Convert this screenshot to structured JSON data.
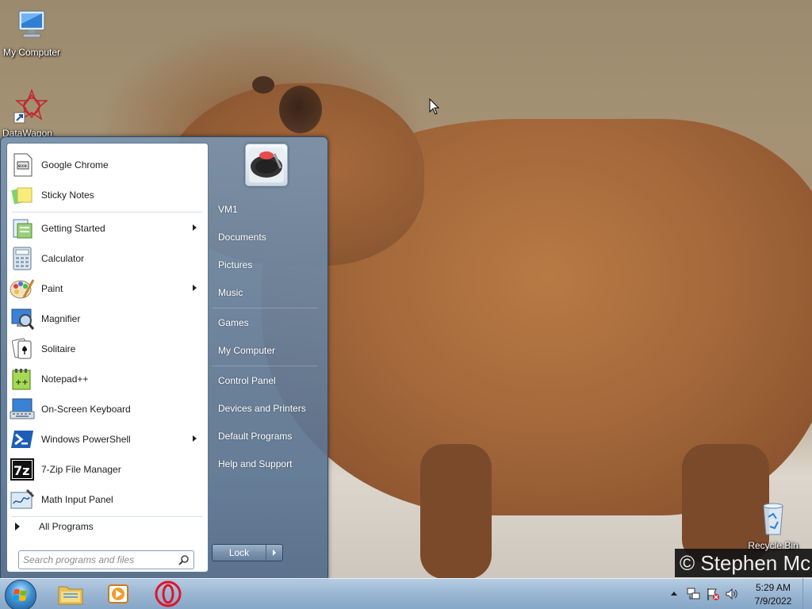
{
  "desktop": {
    "icons": [
      {
        "label": "My Computer"
      },
      {
        "label": "DataWagon"
      },
      {
        "label": "Recycle Bin"
      }
    ],
    "watermark": "© Stephen Mc"
  },
  "start_menu": {
    "programs": [
      {
        "label": "Google Chrome",
        "icon": "chrome-doc-icon",
        "submenu": false
      },
      {
        "label": "Sticky Notes",
        "icon": "sticky-notes-icon",
        "submenu": false
      },
      {
        "label": "Getting Started",
        "icon": "getting-started-icon",
        "submenu": true
      },
      {
        "label": "Calculator",
        "icon": "calculator-icon",
        "submenu": false
      },
      {
        "label": "Paint",
        "icon": "paint-icon",
        "submenu": true
      },
      {
        "label": "Magnifier",
        "icon": "magnifier-icon",
        "submenu": false
      },
      {
        "label": "Solitaire",
        "icon": "solitaire-icon",
        "submenu": false
      },
      {
        "label": "Notepad++",
        "icon": "notepad-plus-icon",
        "submenu": false
      },
      {
        "label": "On-Screen Keyboard",
        "icon": "keyboard-icon",
        "submenu": false
      },
      {
        "label": "Windows PowerShell",
        "icon": "powershell-icon",
        "submenu": true
      },
      {
        "label": "7-Zip File Manager",
        "icon": "seven-zip-icon",
        "submenu": false
      },
      {
        "label": "Math Input Panel",
        "icon": "math-input-icon",
        "submenu": false
      }
    ],
    "all_programs": "All Programs",
    "search_placeholder": "Search programs and files",
    "right_items": [
      {
        "label": "VM1"
      },
      {
        "label": "Documents"
      },
      {
        "label": "Pictures"
      },
      {
        "label": "Music"
      },
      {
        "label": "Games"
      },
      {
        "label": "My Computer"
      },
      {
        "label": "Control Panel"
      },
      {
        "label": "Devices and Printers"
      },
      {
        "label": "Default Programs"
      },
      {
        "label": "Help and Support"
      }
    ],
    "lock_label": "Lock"
  },
  "taskbar": {
    "apps": [
      "file-explorer-icon",
      "media-player-icon",
      "opera-icon"
    ],
    "clock_time": "5:29 AM",
    "clock_date": "7/9/2022"
  }
}
